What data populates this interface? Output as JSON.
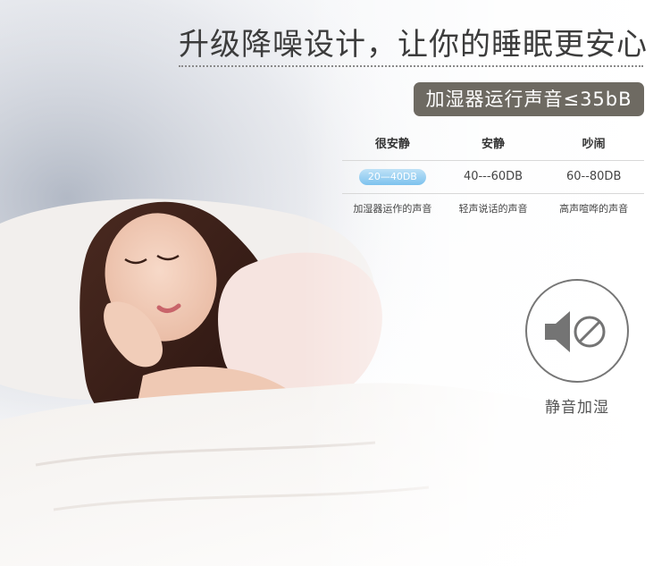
{
  "headline": "升级降噪设计，让你的睡眠更安心",
  "badge": "加湿器运行声音≤35bB",
  "table": {
    "headers": [
      "很安静",
      "安静",
      "吵闹"
    ],
    "ranges": [
      "20—40DB",
      "40---60DB",
      "60--80DB"
    ],
    "descriptions": [
      "加湿器运作的声音",
      "轻声说话的声音",
      "高声喧哗的声音"
    ],
    "highlight_color": "#7dc2ee"
  },
  "mute": {
    "icon": "speaker-muted-icon",
    "label": "静音加湿"
  }
}
